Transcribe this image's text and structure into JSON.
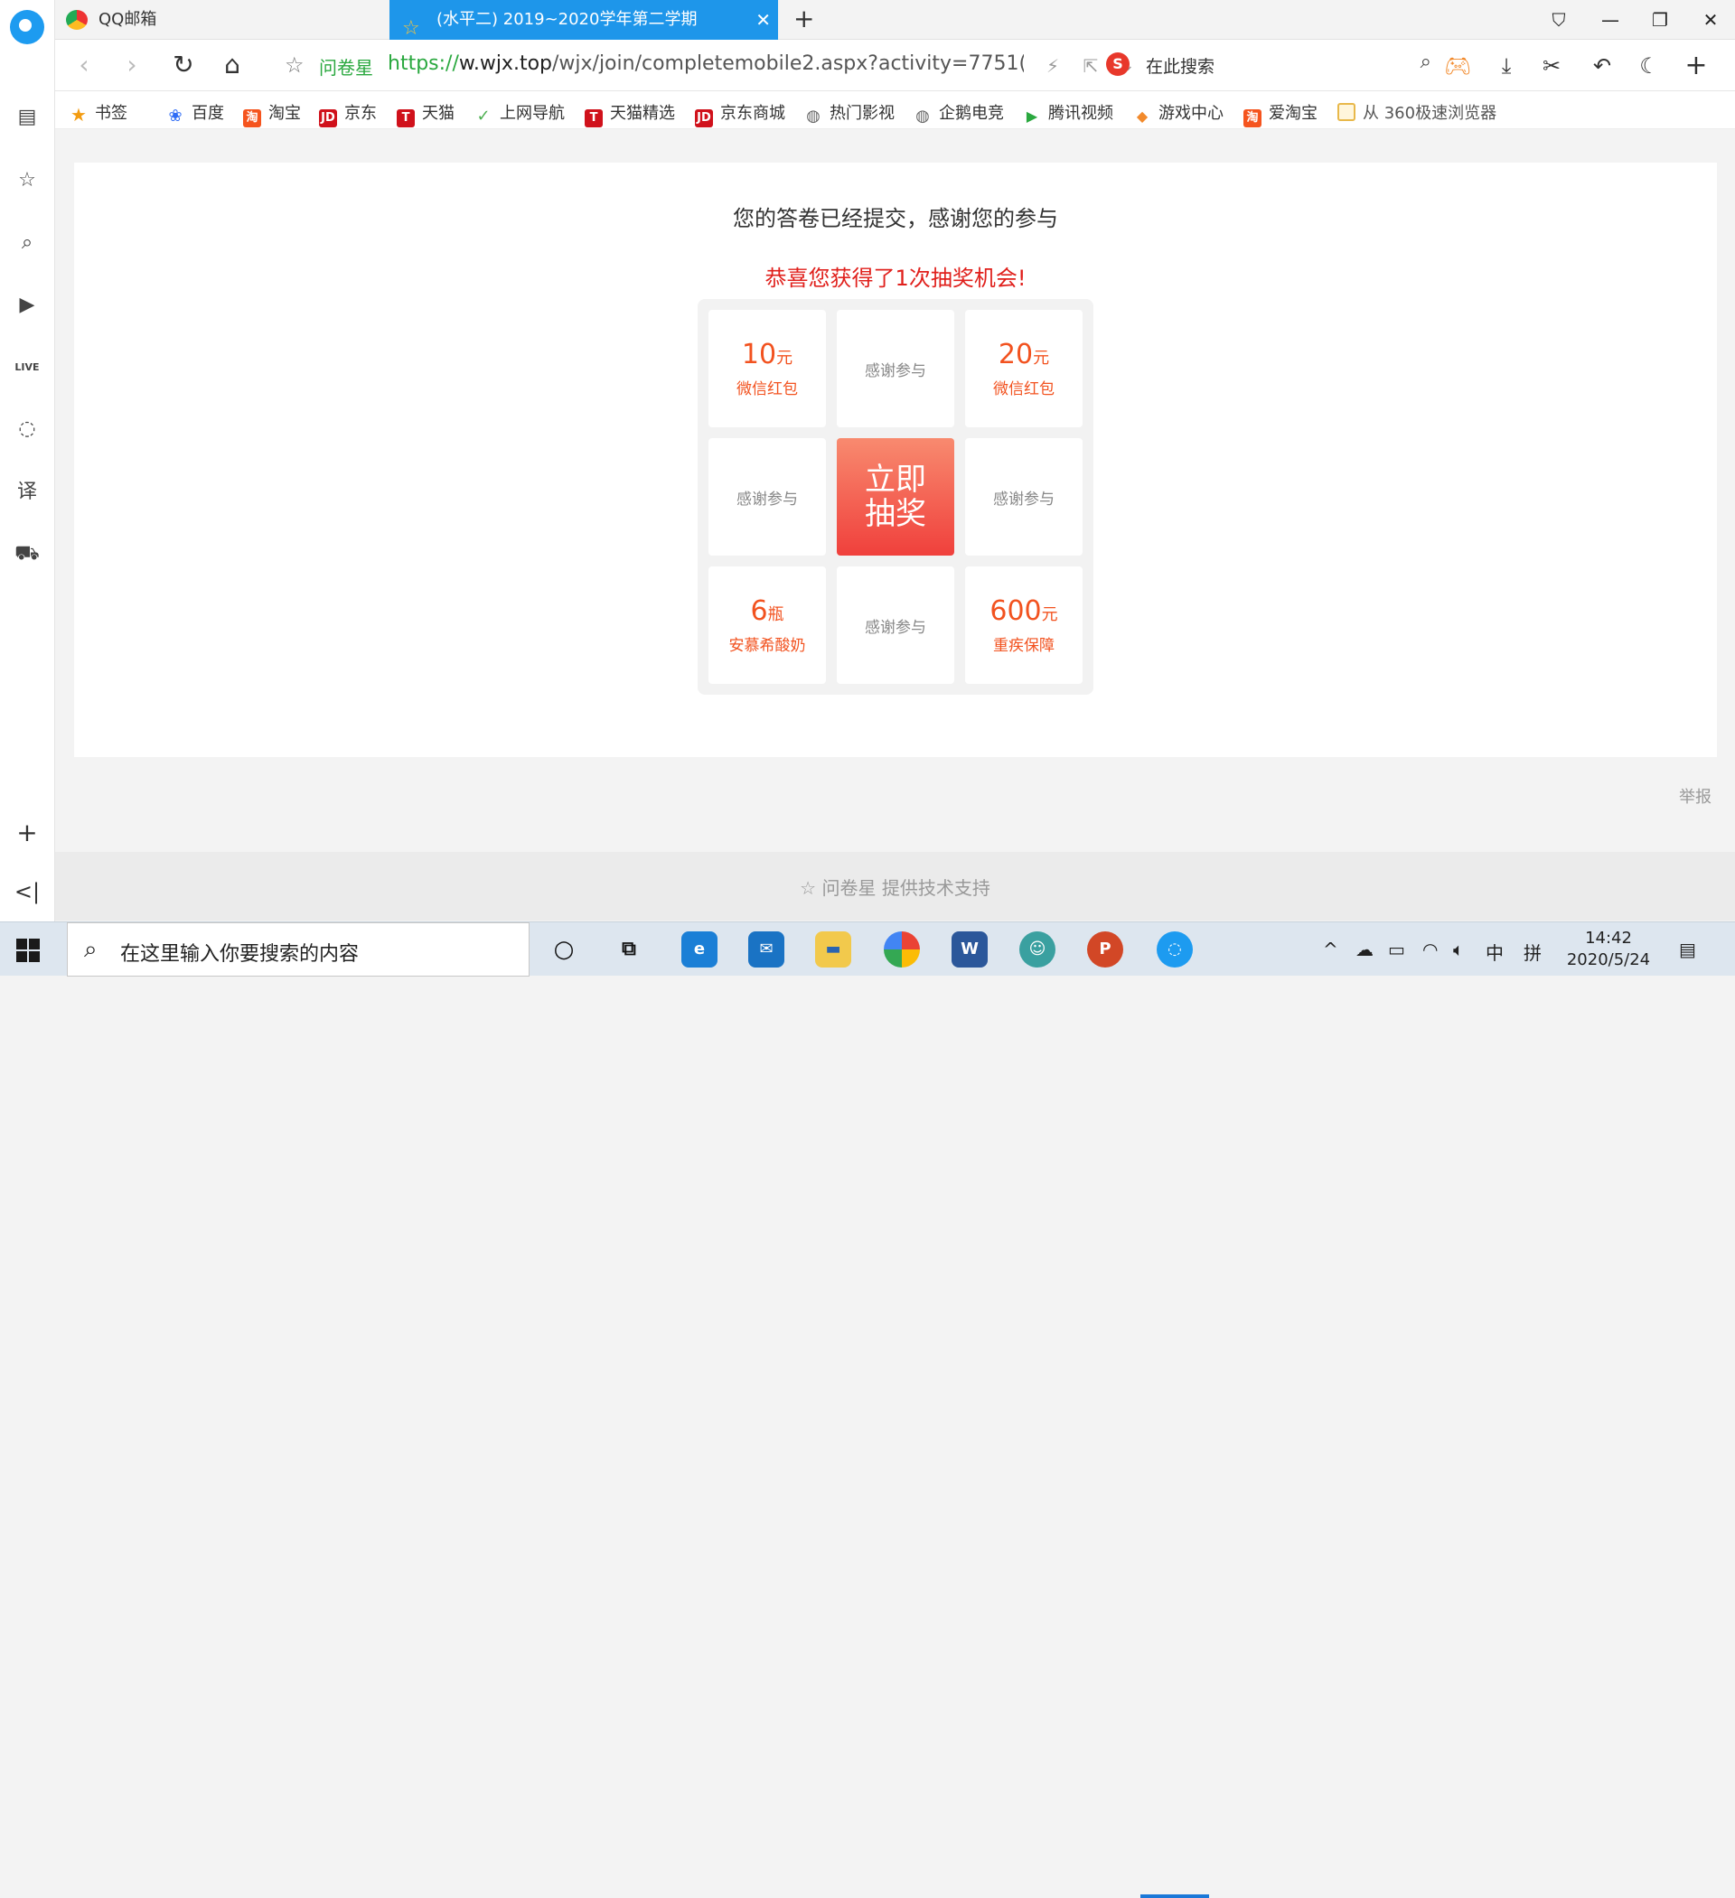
{
  "tabs": [
    {
      "label": "QQ邮箱"
    },
    {
      "label": "(水平二) 2019~2020学年第二学期"
    }
  ],
  "address": {
    "site_name": "问卷星",
    "url_scheme": "https://",
    "url_domain": "w.wjx.top",
    "url_path": "/wjx/join/completemobile2.aspx?activity=7751("
  },
  "search": {
    "placeholder": "在此搜索"
  },
  "bookmarks": [
    {
      "label": "书签"
    },
    {
      "label": "百度"
    },
    {
      "label": "淘宝"
    },
    {
      "label": "京东"
    },
    {
      "label": "天猫"
    },
    {
      "label": "上网导航"
    },
    {
      "label": "天猫精选"
    },
    {
      "label": "京东商城"
    },
    {
      "label": "热门影视"
    },
    {
      "label": "企鹅电竞"
    },
    {
      "label": "腾讯视频"
    },
    {
      "label": "游戏中心"
    },
    {
      "label": "爱淘宝"
    },
    {
      "label": "从 360极速浏览器"
    }
  ],
  "page": {
    "submitted_message": "您的答卷已经提交，感谢您的参与",
    "lottery_message": "恭喜您获得了1次抽奖机会!",
    "prizes": {
      "p1_amount": "10",
      "p1_unit": "元",
      "p1_desc": "微信红包",
      "p2_thanks": "感谢参与",
      "p3_amount": "20",
      "p3_unit": "元",
      "p3_desc": "微信红包",
      "p4_thanks": "感谢参与",
      "draw_line1": "立即",
      "draw_line2": "抽奖",
      "p6_thanks": "感谢参与",
      "p7_amount": "6",
      "p7_unit": "瓶",
      "p7_desc": "安慕希酸奶",
      "p8_thanks": "感谢参与",
      "p9_amount": "600",
      "p9_unit": "元",
      "p9_desc": "重疾保障"
    },
    "report_link": "举报",
    "footer": "问卷星 提供技术支持"
  },
  "taskbar": {
    "search_placeholder": "在这里输入你要搜索的内容",
    "ime_lang": "中",
    "ime_mode": "拼",
    "time": "14:42",
    "date": "2020/5/24"
  },
  "colors": {
    "accent": "#1e96ea",
    "prize": "#f2521f",
    "lottery_red": "#e0201c",
    "draw_top": "#f88a6f",
    "draw_bottom": "#f0403c"
  }
}
